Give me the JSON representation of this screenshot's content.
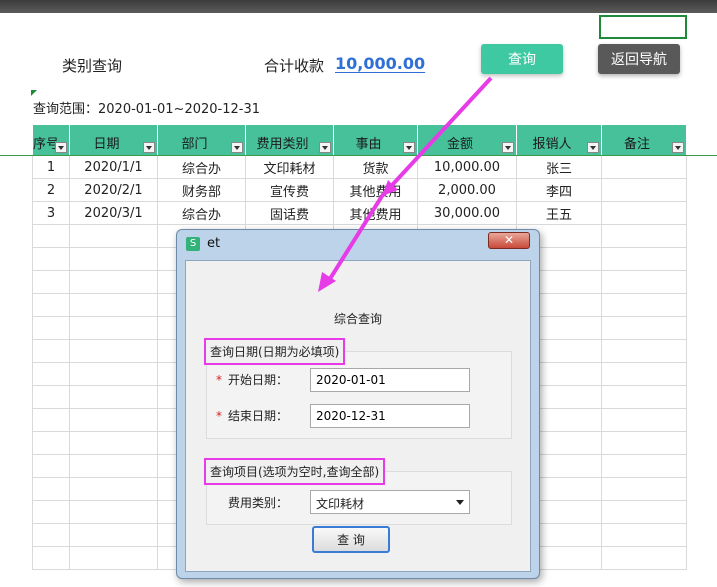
{
  "header": {
    "category_query_label": "类别查询",
    "total_label": "合计收款",
    "total_value": "10,000.00",
    "query_button": "查询",
    "back_button": "返回导航",
    "range_text": "查询范围：2020-01-01~2020-12-31"
  },
  "sheet": {
    "columns": [
      "序号",
      "日期",
      "部门",
      "费用类别",
      "事由",
      "金额",
      "报销人",
      "备注"
    ],
    "rows": [
      [
        "1",
        "2020/1/1",
        "综合办",
        "文印耗材",
        "货款",
        "10,000.00",
        "张三",
        ""
      ],
      [
        "2",
        "2020/2/1",
        "财务部",
        "宣传费",
        "其他费用",
        "2,000.00",
        "李四",
        ""
      ],
      [
        "3",
        "2020/3/1",
        "综合办",
        "固话费",
        "其他费用",
        "30,000.00",
        "王五",
        ""
      ]
    ]
  },
  "dialog": {
    "title": "et",
    "close_glyph": "✕",
    "app_icon_glyph": "S",
    "heading": "综合查询",
    "date_group_title": "查询日期(日期为必填项)",
    "start_label": "开始日期：",
    "start_value": "2020-01-01",
    "end_label": "结束日期：",
    "end_value": "2020-12-31",
    "required_mark": "*",
    "item_group_title": "查询项目(选项为空时,查询全部)",
    "category_label": "费用类别：",
    "category_value": "文印耗材",
    "submit_button": "查 询"
  },
  "colors": {
    "header_green": "#46c19a",
    "query_button": "#3fc9a2",
    "nav_button": "#595959",
    "total_link": "#2f6fd6",
    "annotation_magenta": "#e63be6"
  }
}
